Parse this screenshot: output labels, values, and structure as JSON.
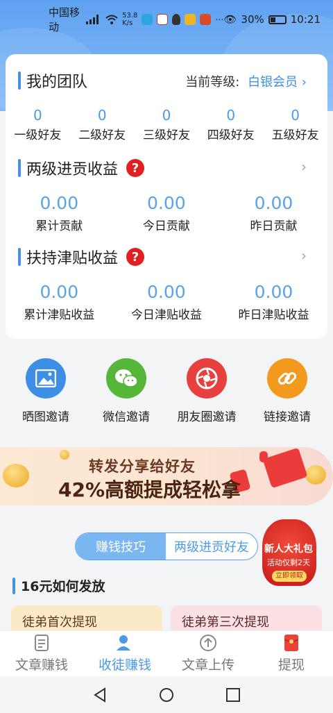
{
  "status_bar": {
    "carrier": "中国移动",
    "net_speed": "53.8",
    "net_unit": "K/s",
    "battery": "30%",
    "time": "10:21"
  },
  "team": {
    "title": "我的团队",
    "level_label": "当前等级:",
    "level_value": "白银会员",
    "friends": [
      {
        "value": "0",
        "label": "一级好友"
      },
      {
        "value": "0",
        "label": "二级好友"
      },
      {
        "value": "0",
        "label": "三级好友"
      },
      {
        "value": "0",
        "label": "四级好友"
      },
      {
        "value": "0",
        "label": "五级好友"
      }
    ]
  },
  "contrib": {
    "title": "两级进贡收益",
    "help": "?",
    "stats": [
      {
        "value": "0.00",
        "label": "累计贡献"
      },
      {
        "value": "0.00",
        "label": "今日贡献"
      },
      {
        "value": "0.00",
        "label": "昨日贡献"
      }
    ]
  },
  "allowance": {
    "title": "扶持津贴收益",
    "help": "?",
    "stats": [
      {
        "value": "0.00",
        "label": "累计津贴收益"
      },
      {
        "value": "0.00",
        "label": "今日津贴收益"
      },
      {
        "value": "0.00",
        "label": "昨日津贴收益"
      }
    ]
  },
  "invite": [
    {
      "label": "晒图邀请",
      "icon": "image-icon",
      "color": "#3d8fe6"
    },
    {
      "label": "微信邀请",
      "icon": "wechat-icon",
      "color": "#55b63a"
    },
    {
      "label": "朋友圈邀请",
      "icon": "moments-icon",
      "color": "#e83f3f"
    },
    {
      "label": "链接邀请",
      "icon": "link-icon",
      "color": "#f39a1e"
    }
  ],
  "banner": {
    "line1": "转发分享给好友",
    "line2": "42%高额提成轻松拿"
  },
  "tabs": {
    "active": "赚钱技巧",
    "inactive": "两级进贡好友"
  },
  "gift": {
    "title": "新人大礼包",
    "subtitle": "活动仅剩2天",
    "button": "立即领取"
  },
  "section": {
    "title": "16元如何发放",
    "card1": "徒弟首次提现",
    "card2": "徒弟第三次提现"
  },
  "nav": [
    {
      "label": "文章赚钱",
      "icon": "article-icon"
    },
    {
      "label": "收徒赚钱",
      "icon": "add-user-icon"
    },
    {
      "label": "文章上传",
      "icon": "upload-icon"
    },
    {
      "label": "提现",
      "icon": "red-envelope-icon"
    }
  ],
  "colors": {
    "accent": "#4a9ae8",
    "header": "#5fa2f2",
    "danger": "#e02020"
  }
}
